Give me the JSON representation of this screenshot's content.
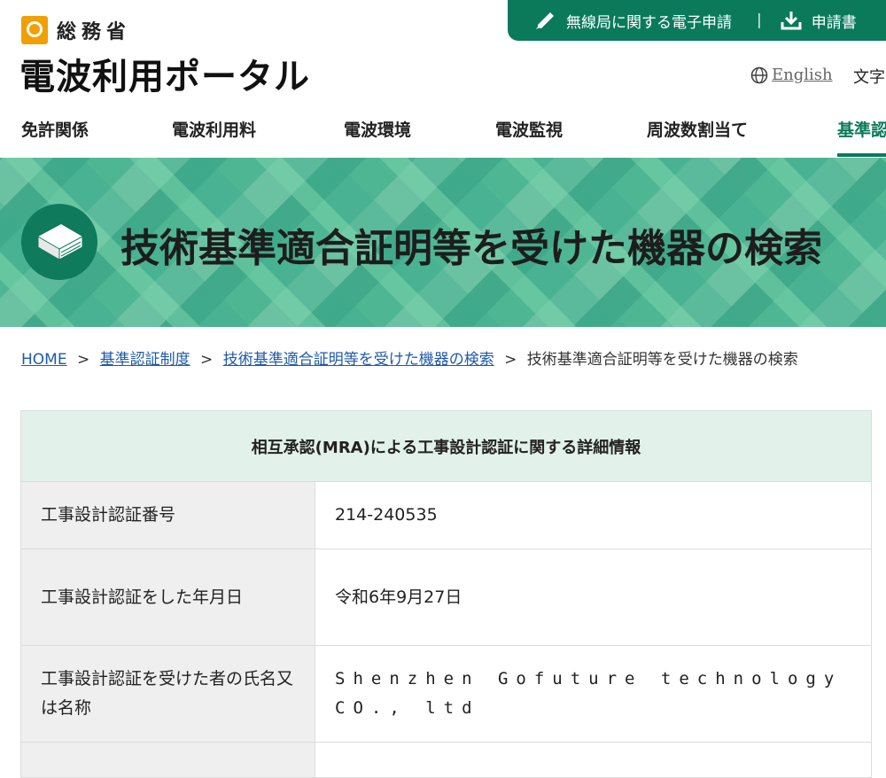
{
  "top_bar": {
    "link1_label": "無線局に関する電子申請",
    "link2_label": "申請書"
  },
  "logo": {
    "ministry": "総務省",
    "portal": "電波利用ポータル"
  },
  "header": {
    "english": "English",
    "moji": "文字"
  },
  "nav": {
    "items": [
      "免許関係",
      "電波利用料",
      "電波環境",
      "電波監視",
      "周波数割当て",
      "基準認"
    ]
  },
  "banner": {
    "title": "技術基準適合証明等を受けた機器の検索"
  },
  "breadcrumb": {
    "home": "HOME",
    "sep": ">",
    "level1": "基準認証制度",
    "level2": "技術基準適合証明等を受けた機器の検索",
    "current": "技術基準適合証明等を受けた機器の検索"
  },
  "detail": {
    "caption": "相互承認(MRA)による工事設計認証に関する詳細情報",
    "rows": [
      {
        "label": "工事設計認証番号",
        "value": "214-240535"
      },
      {
        "label": "工事設計認証をした年月日",
        "value": "令和6年9月27日"
      },
      {
        "label": "工事設計認証を受けた者の氏名又は名称",
        "value": "Shenzhen Gofuture technology CO., ltd"
      }
    ]
  },
  "colors": {
    "brand_green": "#0a7a5b",
    "header_row": "#e2f1ea",
    "label_bg": "#efefef",
    "link": "#1e5aa8"
  }
}
